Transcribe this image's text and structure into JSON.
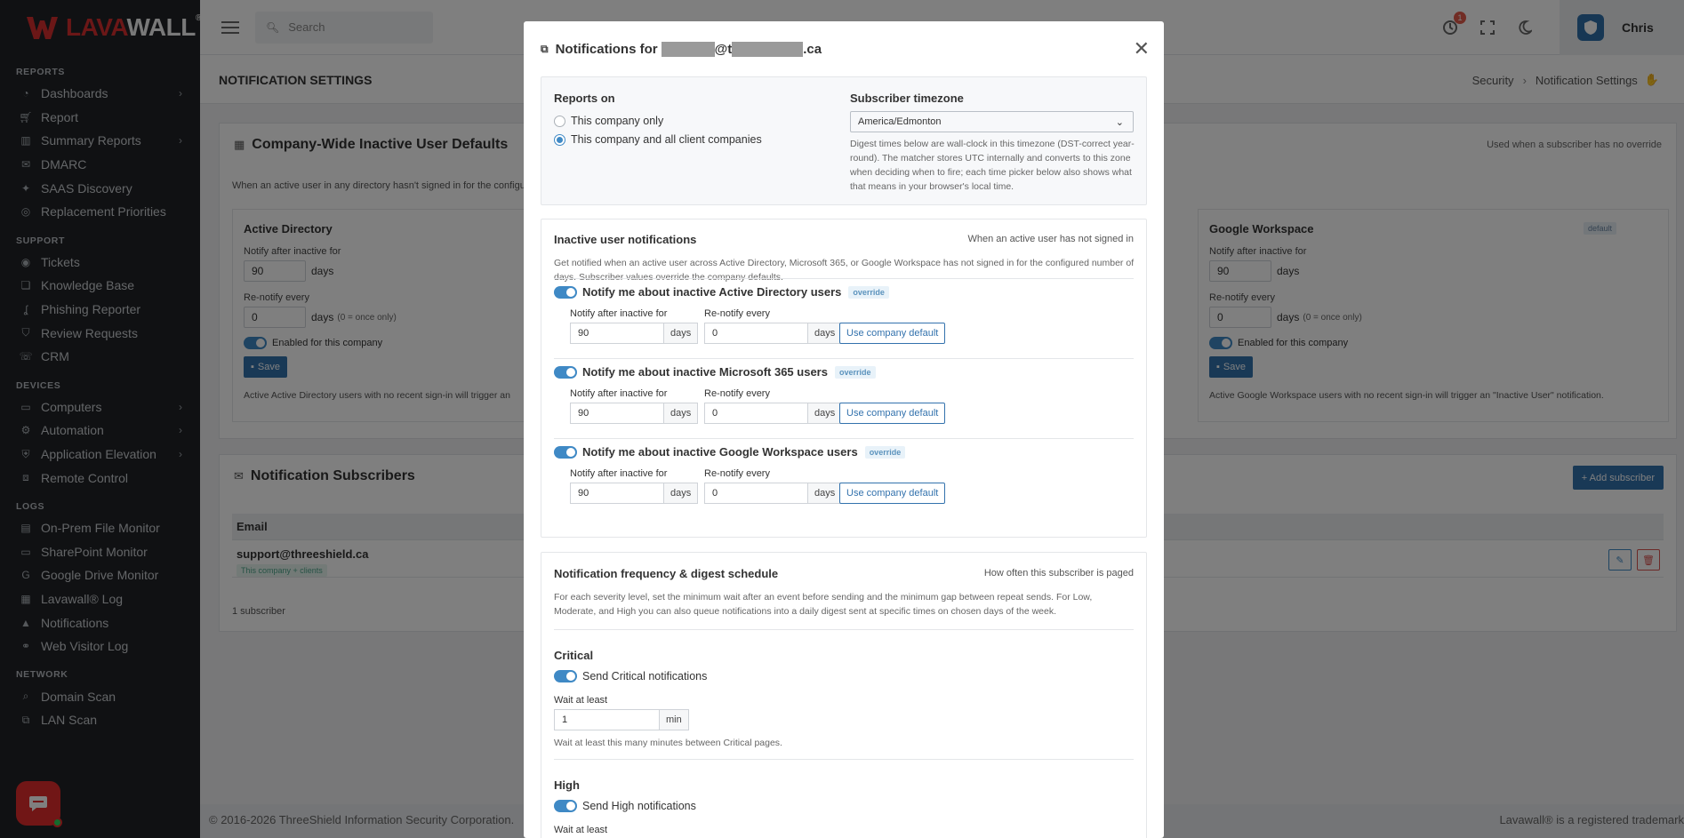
{
  "brand": {
    "lava": "LAVA",
    "wall": "WALL",
    "reg": "®",
    "accent": "#d62f2f"
  },
  "sidebar": {
    "sections": [
      {
        "title": "REPORTS",
        "items": [
          {
            "label": "Dashboards",
            "icon": "dashboard-icon",
            "chevron": true
          },
          {
            "label": "Report",
            "icon": "cart-icon",
            "chevron": false
          },
          {
            "label": "Summary Reports",
            "icon": "chart-icon",
            "chevron": true
          },
          {
            "label": "DMARC",
            "icon": "mail-icon",
            "chevron": false
          },
          {
            "label": "SAAS Discovery",
            "icon": "sparkle-icon",
            "chevron": false
          },
          {
            "label": "Replacement Priorities",
            "icon": "target-icon",
            "chevron": false
          }
        ]
      },
      {
        "title": "SUPPORT",
        "items": [
          {
            "label": "Tickets",
            "icon": "eye-icon",
            "chevron": false
          },
          {
            "label": "Knowledge Base",
            "icon": "book-icon",
            "chevron": false
          },
          {
            "label": "Phishing Reporter",
            "icon": "hook-icon",
            "chevron": false
          },
          {
            "label": "Review Requests",
            "icon": "shield-check-icon",
            "chevron": false
          },
          {
            "label": "CRM",
            "icon": "crm-icon",
            "chevron": false
          }
        ]
      },
      {
        "title": "DEVICES",
        "items": [
          {
            "label": "Computers",
            "icon": "monitor-icon",
            "chevron": true
          },
          {
            "label": "Automation",
            "icon": "robot-icon",
            "chevron": true
          },
          {
            "label": "Application Elevation",
            "icon": "shield-icon",
            "chevron": true
          },
          {
            "label": "Remote Control",
            "icon": "remote-icon",
            "chevron": false
          }
        ]
      },
      {
        "title": "LOGS",
        "items": [
          {
            "label": "On-Prem File Monitor",
            "icon": "file-icon",
            "chevron": false
          },
          {
            "label": "SharePoint Monitor",
            "icon": "monitor-icon",
            "chevron": false
          },
          {
            "label": "Google Drive Monitor",
            "icon": "google-icon",
            "chevron": false
          },
          {
            "label": "Lavawall® Log",
            "icon": "log-icon",
            "chevron": false
          },
          {
            "label": "Notifications",
            "icon": "warning-icon",
            "chevron": false
          },
          {
            "label": "Web Visitor Log",
            "icon": "link-icon",
            "chevron": false
          }
        ]
      },
      {
        "title": "NETWORK",
        "items": [
          {
            "label": "Domain Scan",
            "icon": "search-icon",
            "chevron": false
          },
          {
            "label": "LAN Scan",
            "icon": "network-icon",
            "chevron": false
          }
        ]
      }
    ]
  },
  "topbar": {
    "search_placeholder": "Search",
    "notif_count": "1",
    "user": "Chris"
  },
  "page": {
    "title": "NOTIFICATION SETTINGS",
    "breadcrumb": [
      "Security",
      "Notification Settings"
    ],
    "defaults_card": {
      "title": "Company-Wide Inactive User Defaults",
      "note": "Used when a subscriber has no override",
      "desc": "When an active user in any directory hasn't signed in for the configu",
      "ad": {
        "title": "Active Directory",
        "notify_label": "Notify after inactive for",
        "notify_value": "90",
        "days": "days",
        "renotify_label": "Re-notify every",
        "renotify_value": "0",
        "once_hint": "(0 = once only)",
        "enabled": "Enabled for this company",
        "save": "Save",
        "footnote": "Active Active Directory users with no recent sign-in will trigger an"
      },
      "gw": {
        "title": "Google Workspace",
        "tag": "default",
        "notify_label": "Notify after inactive for",
        "notify_value": "90",
        "days": "days",
        "renotify_label": "Re-notify every",
        "renotify_value": "0",
        "once_hint": "(0 = once only)",
        "enabled": "Enabled for this company",
        "save": "Save",
        "footnote": "Active Google Workspace users with no recent sign-in will trigger an \"Inactive User\" notification."
      }
    },
    "subscribers_card": {
      "title": "Notification Subscribers",
      "add": "+ Add subscriber",
      "col_email": "Email",
      "email": "support@threeshield.ca",
      "scope_tag": "This company + clients",
      "count": "1 subscriber"
    },
    "footer_left": "© 2016-2026 ThreeShield Information Security Corporation.",
    "footer_right": "Lavawall® is a registered trademark"
  },
  "modal": {
    "title_prefix": "Notifications for",
    "title_at": "@t",
    "title_suffix": ".ca",
    "reports": {
      "heading": "Reports on",
      "opt1": "This company only",
      "opt2": "This company and all client companies",
      "selected": 2
    },
    "timezone": {
      "heading": "Subscriber timezone",
      "value": "America/Edmonton",
      "help": "Digest times below are wall-clock in this timezone (DST-correct year-round). The matcher stores UTC internally and converts to this zone when deciding when to fire; each time picker below also shows what that means in your browser's local time."
    },
    "inactive": {
      "heading": "Inactive user notifications",
      "note": "When an active user has not signed in",
      "desc": "Get notified when an active user across Active Directory, Microsoft 365, or Google Workspace has not signed in for the configured number of days. Subscriber values override the company defaults.",
      "rows": [
        {
          "label": "Notify me about inactive Active Directory users",
          "tag": "override",
          "notify_label": "Notify after inactive for",
          "notify_value": "90",
          "renotify_label": "Re-notify every",
          "renotify_value": "0",
          "unit": "days",
          "reset": "Use company default"
        },
        {
          "label": "Notify me about inactive Microsoft 365 users",
          "tag": "override",
          "notify_label": "Notify after inactive for",
          "notify_value": "90",
          "renotify_label": "Re-notify every",
          "renotify_value": "0",
          "unit": "days",
          "reset": "Use company default"
        },
        {
          "label": "Notify me about inactive Google Workspace users",
          "tag": "override",
          "notify_label": "Notify after inactive for",
          "notify_value": "90",
          "renotify_label": "Re-notify every",
          "renotify_value": "0",
          "unit": "days",
          "reset": "Use company default"
        }
      ]
    },
    "frequency": {
      "heading": "Notification frequency & digest schedule",
      "note": "How often this subscriber is paged",
      "desc": "For each severity level, set the minimum wait after an event before sending and the minimum gap between repeat sends. For Low, Moderate, and High you can also queue notifications into a daily digest sent at specific times on chosen days of the week.",
      "critical": {
        "title": "Critical",
        "toggle": "Send Critical notifications",
        "wait_label": "Wait at least",
        "wait_value": "1",
        "wait_unit": "min",
        "help": "Wait at least this many minutes between Critical pages."
      },
      "high": {
        "title": "High",
        "toggle": "Send High notifications",
        "wait_label": "Wait at least"
      }
    }
  }
}
